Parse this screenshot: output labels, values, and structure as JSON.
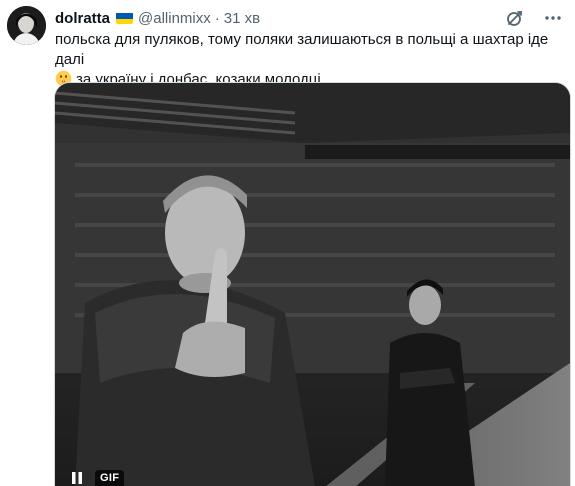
{
  "tweet": {
    "display_name": "dolratta",
    "badge_icon": "ukraine-flag-icon",
    "handle": "@allinmixx",
    "separator": "·",
    "timestamp": "31 хв",
    "text_line1": "польска для пуляков, тому поляки залишаються в польщі а шахтар іде далі",
    "emoji_icon": "shushing-face-emoji",
    "text_line2": "за україну і донбас, козаки молодці"
  },
  "actions": {
    "grok_icon": "grok-icon",
    "more_icon": "more-dots-icon"
  },
  "media": {
    "type": "gif",
    "gif_label": "GIF",
    "pause_icon": "pause-icon"
  },
  "colors": {
    "text_primary": "#0f1419",
    "text_secondary": "#536471",
    "border": "#cfd9de",
    "flag_blue": "#0057b7",
    "flag_yellow": "#ffd700"
  }
}
